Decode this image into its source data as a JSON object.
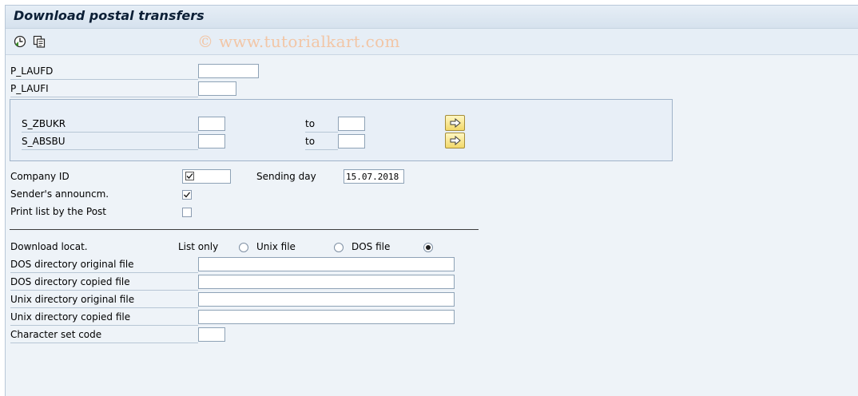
{
  "window": {
    "title": "Download postal transfers"
  },
  "toolbar": {
    "watermark": "© www.tutorialkart.com",
    "icons": [
      "execute-icon",
      "variant-icon"
    ]
  },
  "params": {
    "p_laufd": {
      "label": "P_LAUFD",
      "value": ""
    },
    "p_laufi": {
      "label": "P_LAUFI",
      "value": ""
    }
  },
  "select_options": {
    "s_zbukr": {
      "label": "S_ZBUKR",
      "from": "",
      "to_label": "to",
      "to": ""
    },
    "s_absbu": {
      "label": "S_ABSBU",
      "from": "",
      "to_label": "to",
      "to": ""
    }
  },
  "company_id": {
    "label": "Company ID",
    "checked": true
  },
  "sending_day": {
    "label": "Sending day",
    "value": "15.07.2018"
  },
  "sender_announce": {
    "label": "Sender's announcm.",
    "checked": true
  },
  "print_list": {
    "label": "Print list by the Post",
    "checked": false
  },
  "download": {
    "label": "Download locat.",
    "options": [
      "List only",
      "Unix file",
      "DOS file"
    ],
    "selected": "DOS file"
  },
  "files": {
    "dos_original": {
      "label": "DOS directory original file",
      "value": ""
    },
    "dos_copied": {
      "label": "DOS directory copied file",
      "value": ""
    },
    "unix_original": {
      "label": "Unix directory original file",
      "value": ""
    },
    "unix_copied": {
      "label": "Unix directory copied file",
      "value": ""
    },
    "charset": {
      "label": "Character set code",
      "value": ""
    }
  }
}
